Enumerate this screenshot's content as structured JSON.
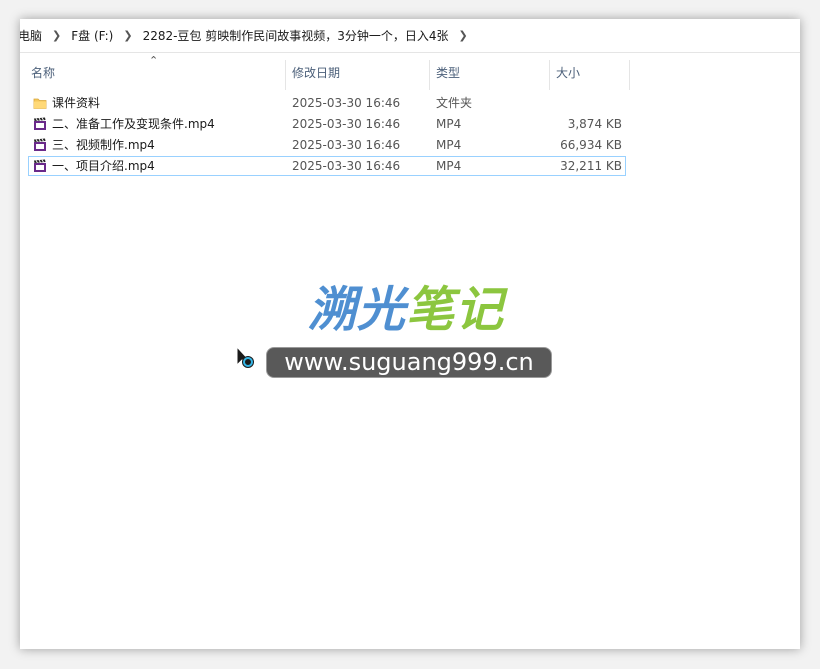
{
  "breadcrumb": {
    "items": [
      "电脑",
      "F盘 (F:)",
      "2282-豆包 剪映制作民间故事视频，3分钟一个，日入4张"
    ]
  },
  "columns": {
    "name": "名称",
    "date": "修改日期",
    "type": "类型",
    "size": "大小"
  },
  "files": [
    {
      "name": "课件资料",
      "date": "2025-03-30 16:46",
      "type": "文件夹",
      "size": "",
      "icon": "folder-icon"
    },
    {
      "name": "二、准备工作及变现条件.mp4",
      "date": "2025-03-30 16:46",
      "type": "MP4",
      "size": "3,874 KB",
      "icon": "video-file-icon"
    },
    {
      "name": "三、视频制作.mp4",
      "date": "2025-03-30 16:46",
      "type": "MP4",
      "size": "66,934 KB",
      "icon": "video-file-icon"
    },
    {
      "name": "一、项目介绍.mp4",
      "date": "2025-03-30 16:46",
      "type": "MP4",
      "size": "32,211 KB",
      "icon": "video-file-icon"
    }
  ],
  "watermark": {
    "logo_part1": "溯光",
    "logo_part2": "笔记",
    "url": "www.suguang999.cn",
    "color_blue": "#4f8fd1",
    "color_green": "#8cc63f"
  },
  "colors": {
    "selection_border": "#99d1ff",
    "header_text": "#4c607a",
    "folder": "#f5c85a",
    "video_icon": "#6a2a8a"
  }
}
